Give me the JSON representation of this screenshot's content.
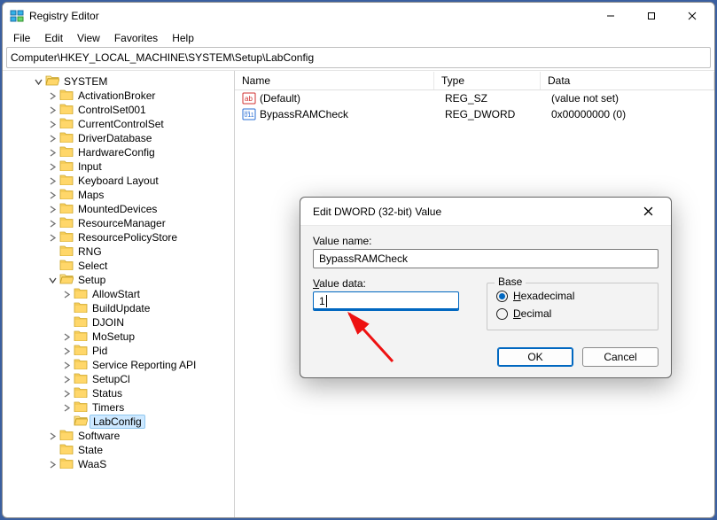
{
  "window": {
    "title": "Registry Editor"
  },
  "menu": {
    "file": "File",
    "edit": "Edit",
    "view": "View",
    "favorites": "Favorites",
    "help": "Help"
  },
  "address": "Computer\\HKEY_LOCAL_MACHINE\\SYSTEM\\Setup\\LabConfig",
  "tree": {
    "system": "SYSTEM",
    "system_children": [
      "ActivationBroker",
      "ControlSet001",
      "CurrentControlSet",
      "DriverDatabase",
      "HardwareConfig",
      "Input",
      "Keyboard Layout",
      "Maps",
      "MountedDevices",
      "ResourceManager",
      "ResourcePolicyStore",
      "RNG",
      "Select"
    ],
    "setup": "Setup",
    "setup_children": [
      "AllowStart",
      "BuildUpdate",
      "DJOIN",
      "MoSetup",
      "Pid",
      "Service Reporting API",
      "SetupCl",
      "Status",
      "Timers",
      "LabConfig"
    ],
    "software": "Software",
    "state": "State",
    "waas": "WaaS"
  },
  "list": {
    "columns": {
      "name": "Name",
      "type": "Type",
      "data": "Data"
    },
    "rows": [
      {
        "name": "(Default)",
        "type": "REG_SZ",
        "data": "(value not set)",
        "kind": "sz"
      },
      {
        "name": "BypassRAMCheck",
        "type": "REG_DWORD",
        "data": "0x00000000 (0)",
        "kind": "dword"
      }
    ]
  },
  "dialog": {
    "title": "Edit DWORD (32-bit) Value",
    "value_name_label": "Value name:",
    "value_name": "BypassRAMCheck",
    "value_data_label": "Value data:",
    "value_data": "1",
    "base_label": "Base",
    "hex": "Hexadecimal",
    "dec": "Decimal",
    "ok": "OK",
    "cancel": "Cancel"
  }
}
